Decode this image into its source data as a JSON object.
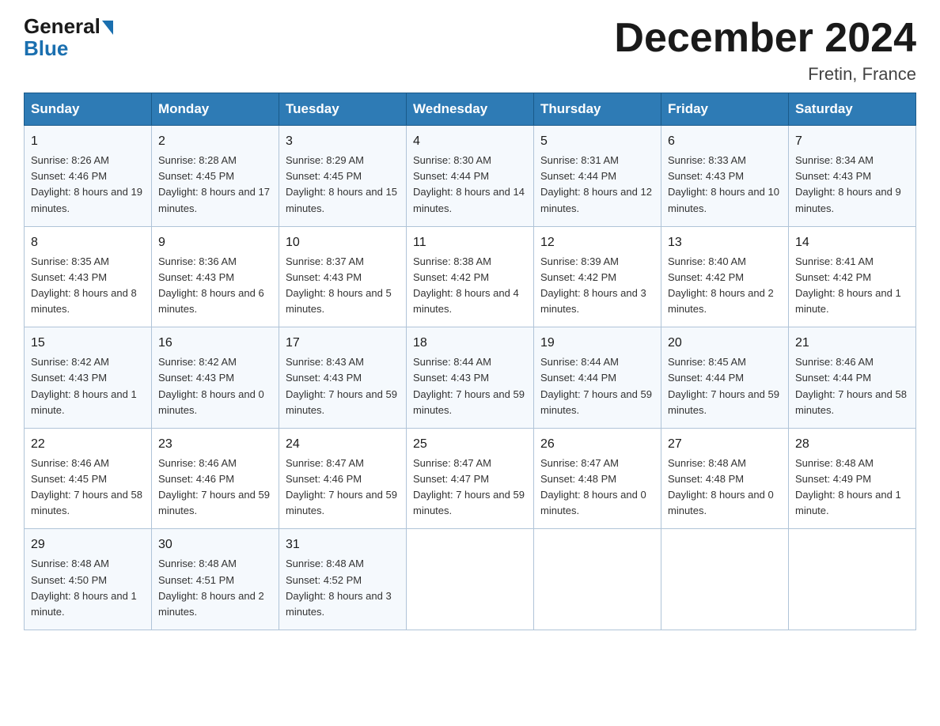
{
  "logo": {
    "general": "General",
    "arrow": "▶",
    "blue": "Blue"
  },
  "header": {
    "title": "December 2024",
    "location": "Fretin, France"
  },
  "days_of_week": [
    "Sunday",
    "Monday",
    "Tuesday",
    "Wednesday",
    "Thursday",
    "Friday",
    "Saturday"
  ],
  "weeks": [
    [
      {
        "day": "1",
        "sunrise": "8:26 AM",
        "sunset": "4:46 PM",
        "daylight": "8 hours and 19 minutes."
      },
      {
        "day": "2",
        "sunrise": "8:28 AM",
        "sunset": "4:45 PM",
        "daylight": "8 hours and 17 minutes."
      },
      {
        "day": "3",
        "sunrise": "8:29 AM",
        "sunset": "4:45 PM",
        "daylight": "8 hours and 15 minutes."
      },
      {
        "day": "4",
        "sunrise": "8:30 AM",
        "sunset": "4:44 PM",
        "daylight": "8 hours and 14 minutes."
      },
      {
        "day": "5",
        "sunrise": "8:31 AM",
        "sunset": "4:44 PM",
        "daylight": "8 hours and 12 minutes."
      },
      {
        "day": "6",
        "sunrise": "8:33 AM",
        "sunset": "4:43 PM",
        "daylight": "8 hours and 10 minutes."
      },
      {
        "day": "7",
        "sunrise": "8:34 AM",
        "sunset": "4:43 PM",
        "daylight": "8 hours and 9 minutes."
      }
    ],
    [
      {
        "day": "8",
        "sunrise": "8:35 AM",
        "sunset": "4:43 PM",
        "daylight": "8 hours and 8 minutes."
      },
      {
        "day": "9",
        "sunrise": "8:36 AM",
        "sunset": "4:43 PM",
        "daylight": "8 hours and 6 minutes."
      },
      {
        "day": "10",
        "sunrise": "8:37 AM",
        "sunset": "4:43 PM",
        "daylight": "8 hours and 5 minutes."
      },
      {
        "day": "11",
        "sunrise": "8:38 AM",
        "sunset": "4:42 PM",
        "daylight": "8 hours and 4 minutes."
      },
      {
        "day": "12",
        "sunrise": "8:39 AM",
        "sunset": "4:42 PM",
        "daylight": "8 hours and 3 minutes."
      },
      {
        "day": "13",
        "sunrise": "8:40 AM",
        "sunset": "4:42 PM",
        "daylight": "8 hours and 2 minutes."
      },
      {
        "day": "14",
        "sunrise": "8:41 AM",
        "sunset": "4:42 PM",
        "daylight": "8 hours and 1 minute."
      }
    ],
    [
      {
        "day": "15",
        "sunrise": "8:42 AM",
        "sunset": "4:43 PM",
        "daylight": "8 hours and 1 minute."
      },
      {
        "day": "16",
        "sunrise": "8:42 AM",
        "sunset": "4:43 PM",
        "daylight": "8 hours and 0 minutes."
      },
      {
        "day": "17",
        "sunrise": "8:43 AM",
        "sunset": "4:43 PM",
        "daylight": "7 hours and 59 minutes."
      },
      {
        "day": "18",
        "sunrise": "8:44 AM",
        "sunset": "4:43 PM",
        "daylight": "7 hours and 59 minutes."
      },
      {
        "day": "19",
        "sunrise": "8:44 AM",
        "sunset": "4:44 PM",
        "daylight": "7 hours and 59 minutes."
      },
      {
        "day": "20",
        "sunrise": "8:45 AM",
        "sunset": "4:44 PM",
        "daylight": "7 hours and 59 minutes."
      },
      {
        "day": "21",
        "sunrise": "8:46 AM",
        "sunset": "4:44 PM",
        "daylight": "7 hours and 58 minutes."
      }
    ],
    [
      {
        "day": "22",
        "sunrise": "8:46 AM",
        "sunset": "4:45 PM",
        "daylight": "7 hours and 58 minutes."
      },
      {
        "day": "23",
        "sunrise": "8:46 AM",
        "sunset": "4:46 PM",
        "daylight": "7 hours and 59 minutes."
      },
      {
        "day": "24",
        "sunrise": "8:47 AM",
        "sunset": "4:46 PM",
        "daylight": "7 hours and 59 minutes."
      },
      {
        "day": "25",
        "sunrise": "8:47 AM",
        "sunset": "4:47 PM",
        "daylight": "7 hours and 59 minutes."
      },
      {
        "day": "26",
        "sunrise": "8:47 AM",
        "sunset": "4:48 PM",
        "daylight": "8 hours and 0 minutes."
      },
      {
        "day": "27",
        "sunrise": "8:48 AM",
        "sunset": "4:48 PM",
        "daylight": "8 hours and 0 minutes."
      },
      {
        "day": "28",
        "sunrise": "8:48 AM",
        "sunset": "4:49 PM",
        "daylight": "8 hours and 1 minute."
      }
    ],
    [
      {
        "day": "29",
        "sunrise": "8:48 AM",
        "sunset": "4:50 PM",
        "daylight": "8 hours and 1 minute."
      },
      {
        "day": "30",
        "sunrise": "8:48 AM",
        "sunset": "4:51 PM",
        "daylight": "8 hours and 2 minutes."
      },
      {
        "day": "31",
        "sunrise": "8:48 AM",
        "sunset": "4:52 PM",
        "daylight": "8 hours and 3 minutes."
      },
      null,
      null,
      null,
      null
    ]
  ]
}
